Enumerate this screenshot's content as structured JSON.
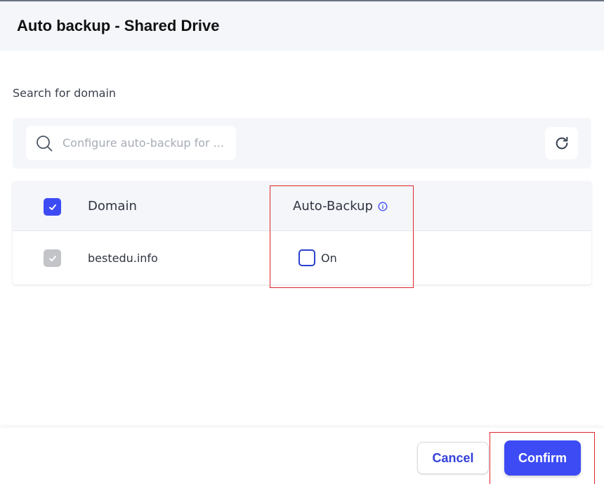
{
  "dialog": {
    "title": "Auto backup - Shared Drive"
  },
  "search": {
    "label": "Search for domain",
    "placeholder": "Configure auto-backup for ...",
    "value": "",
    "search_icon": "search-icon",
    "refresh_icon": "refresh-icon"
  },
  "table": {
    "columns": {
      "domain": "Domain",
      "auto_backup": "Auto-Backup"
    },
    "header_checkbox_checked": true,
    "info_icon": "info-icon",
    "rows": [
      {
        "domain": "bestedu.info",
        "selected": true,
        "selected_disabled": true,
        "auto_backup_label": "On",
        "auto_backup_checked": false
      }
    ]
  },
  "footer": {
    "cancel_label": "Cancel",
    "confirm_label": "Confirm"
  },
  "colors": {
    "accent": "#3d4bf5",
    "header_bg": "#f4f6fa",
    "highlight": "#e0262a",
    "disabled_checkbox": "#c3c4c8"
  }
}
